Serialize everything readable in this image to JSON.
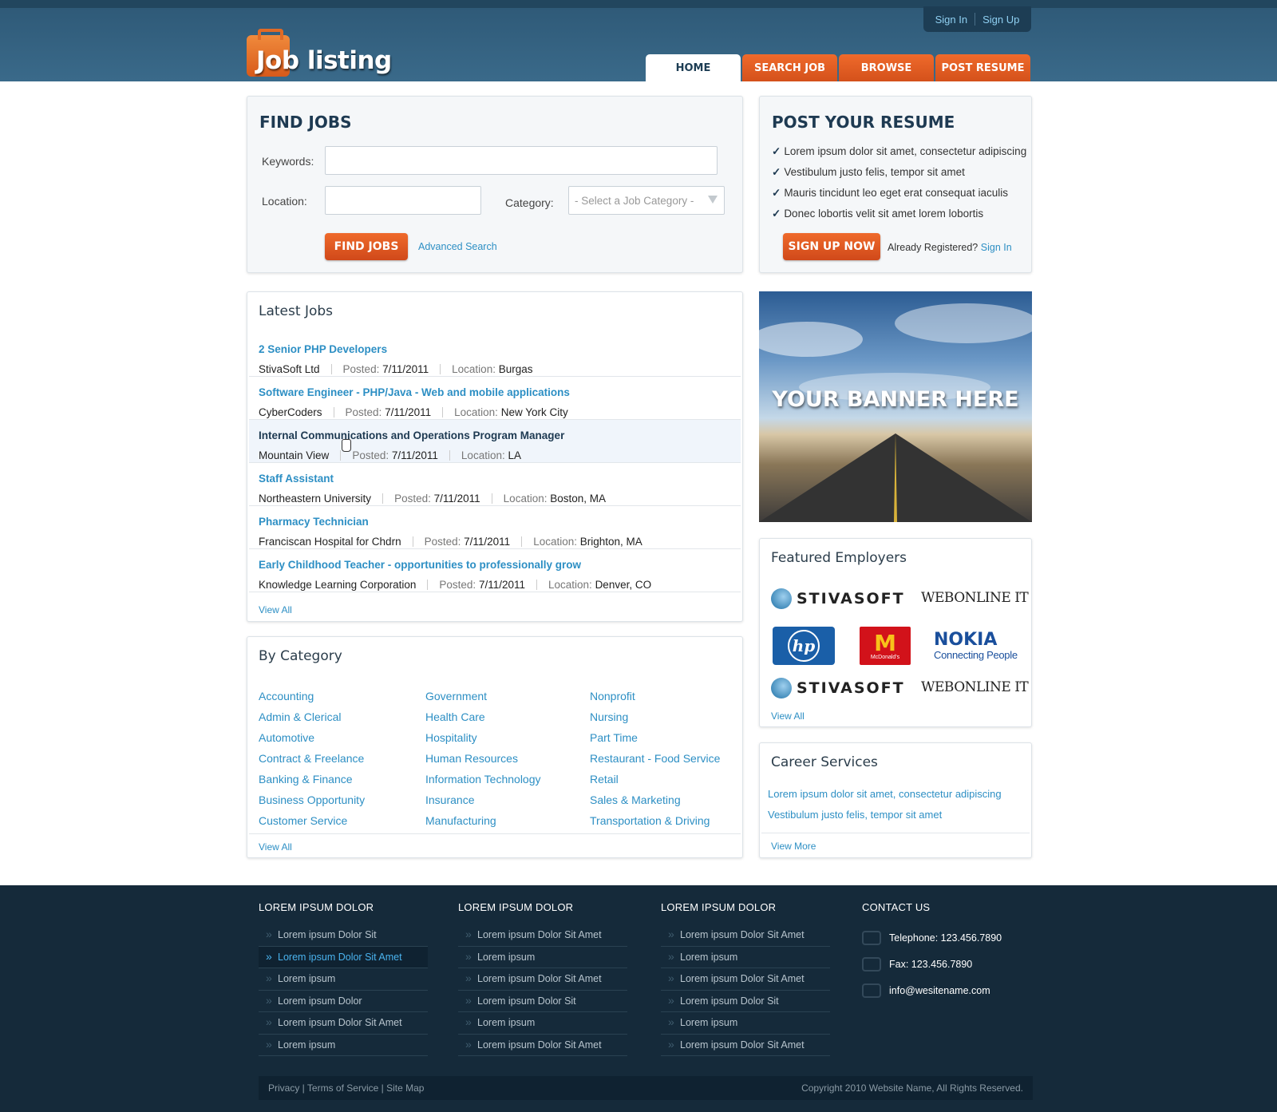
{
  "header": {
    "sign_in": "Sign In",
    "sign_up": "Sign Up",
    "logo_text": "Job listing",
    "nav": [
      "HOME",
      "SEARCH JOB",
      "BROWSE",
      "POST RESUME"
    ]
  },
  "find_jobs": {
    "title": "FIND JOBS",
    "keywords_label": "Keywords:",
    "location_label": "Location:",
    "category_label": "Category:",
    "category_select": "- Select a Job Category -",
    "button": "FIND JOBS",
    "advanced": "Advanced Search"
  },
  "post_resume": {
    "title": "POST YOUR RESUME",
    "items": [
      "Lorem ipsum dolor sit amet, consectetur adipiscing",
      "Vestibulum justo felis, tempor sit amet",
      "Mauris tincidunt leo eget erat consequat iaculis",
      "Donec lobortis velit sit amet lorem lobortis"
    ],
    "button": "SIGN UP NOW",
    "already": "Already Registered?",
    "sign_in": "Sign In"
  },
  "latest_jobs": {
    "title": "Latest Jobs",
    "posted_label": "Posted:",
    "location_label": "Location:",
    "jobs": [
      {
        "title": "2 Senior PHP Developers",
        "company": "StivaSoft Ltd",
        "date": "7/11/2011",
        "location": "Burgas"
      },
      {
        "title": "Software Engineer - PHP/Java - Web and mobile applications",
        "company": "CyberCoders",
        "date": "7/11/2011",
        "location": "New York City"
      },
      {
        "title": "Internal Communications and Operations Program Manager",
        "company": "Mountain View",
        "date": "7/11/2011",
        "location": "LA"
      },
      {
        "title": "Staff Assistant",
        "company": "Northeastern University",
        "date": "7/11/2011",
        "location": "Boston, MA"
      },
      {
        "title": "Pharmacy Technician",
        "company": "Franciscan Hospital for Chdrn",
        "date": "7/11/2011",
        "location": "Brighton, MA"
      },
      {
        "title": "Early Childhood Teacher - opportunities to professionally grow",
        "company": "Knowledge Learning Corporation",
        "date": "7/11/2011",
        "location": "Denver, CO"
      }
    ],
    "view_all": "View All"
  },
  "by_category": {
    "title": "By Category",
    "col1": [
      "Accounting",
      "Admin & Clerical",
      "Automotive",
      "Contract & Freelance",
      "Banking & Finance",
      "Business Opportunity",
      "Customer Service"
    ],
    "col2": [
      "Government",
      "Health Care",
      "Hospitality",
      "Human Resources",
      "Information Technology",
      "Insurance",
      "Manufacturing"
    ],
    "col3": [
      "Nonprofit",
      "Nursing",
      "Part Time",
      "Restaurant - Food Service",
      "Retail",
      "Sales & Marketing",
      "Transportation & Driving"
    ],
    "view_all": "View All"
  },
  "banner": {
    "text": "YOUR BANNER HERE"
  },
  "featured": {
    "title": "Featured Employers",
    "stiva": "STIVASOFT",
    "webonline": "WEBONLINE IT",
    "hp": "hp",
    "mcd_sub": "McDonald's",
    "nokia": "NOKIA",
    "nokia_sub": "Connecting People",
    "view_all": "View All"
  },
  "career": {
    "title": "Career Services",
    "links": [
      "Lorem ipsum dolor sit amet, consectetur adipiscing",
      "Vestibulum justo felis, tempor sit amet"
    ],
    "view_more": "View More"
  },
  "footer": {
    "col1": {
      "title": "LOREM IPSUM DOLOR",
      "items": [
        "Lorem ipsum Dolor Sit",
        "Lorem ipsum Dolor Sit Amet",
        "Lorem ipsum",
        "Lorem ipsum Dolor",
        "Lorem ipsum Dolor Sit Amet",
        "Lorem ipsum"
      ]
    },
    "col2": {
      "title": "LOREM IPSUM DOLOR",
      "items": [
        "Lorem ipsum Dolor Sit Amet",
        "Lorem ipsum",
        "Lorem ipsum Dolor Sit Amet",
        "Lorem ipsum Dolor Sit",
        "Lorem ipsum",
        "Lorem ipsum Dolor Sit Amet"
      ]
    },
    "col3": {
      "title": "LOREM IPSUM DOLOR",
      "items": [
        "Lorem ipsum Dolor Sit Amet",
        "Lorem ipsum",
        "Lorem ipsum Dolor Sit Amet",
        "Lorem ipsum Dolor Sit",
        "Lorem ipsum",
        "Lorem ipsum Dolor Sit Amet"
      ]
    },
    "contact": {
      "title": "CONTACT US",
      "phone": "Telephone: 123.456.7890",
      "fax": "Fax: 123.456.7890",
      "email": "info@wesitename.com"
    },
    "links": [
      "Privacy",
      "Terms of Service",
      "Site Map"
    ],
    "copyright": "Copyright 2010 Website Name, All Rights Reserved."
  }
}
